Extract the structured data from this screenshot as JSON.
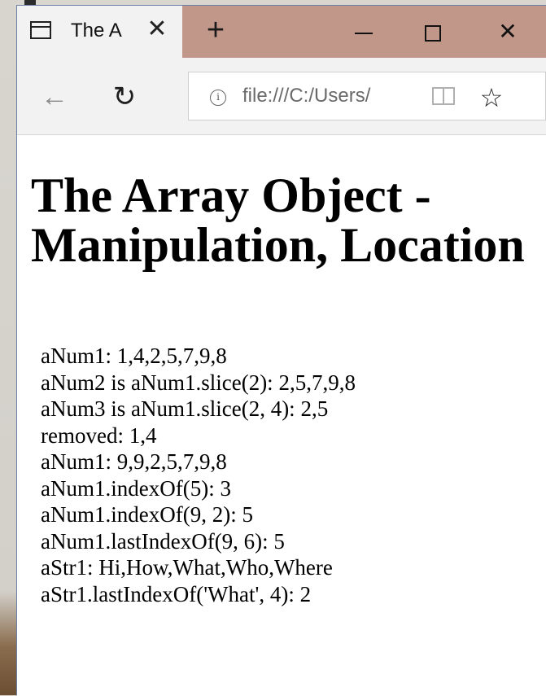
{
  "browser": {
    "tab_title": "The A",
    "tab_close": "✕",
    "new_tab": "+",
    "window_close": "✕",
    "address_url": "file:///C:/Users/",
    "info_glyph": "i",
    "back_glyph": "←",
    "refresh_glyph": "↻",
    "star_glyph": "☆",
    "titlebar_color": "#c1978a",
    "icons": [
      "tab-page-icon",
      "close-icon",
      "plus-icon",
      "minimize-icon",
      "maximize-icon",
      "back-arrow-icon",
      "refresh-icon",
      "info-icon",
      "reading-view-icon",
      "favorite-star-icon"
    ]
  },
  "page": {
    "title_line1": "The Array Object -",
    "title_line2": "Manipulation, Location",
    "output_lines": [
      "aNum1: 1,4,2,5,7,9,8",
      "aNum2 is aNum1.slice(2): 2,5,7,9,8",
      "aNum3 is aNum1.slice(2, 4): 2,5",
      "removed: 1,4",
      "aNum1: 9,9,2,5,7,9,8",
      "aNum1.indexOf(5): 3",
      "aNum1.indexOf(9, 2): 5",
      "aNum1.lastIndexOf(9, 6): 5",
      "aStr1: Hi,How,What,Who,Where",
      "aStr1.lastIndexOf('What', 4): 2"
    ]
  }
}
